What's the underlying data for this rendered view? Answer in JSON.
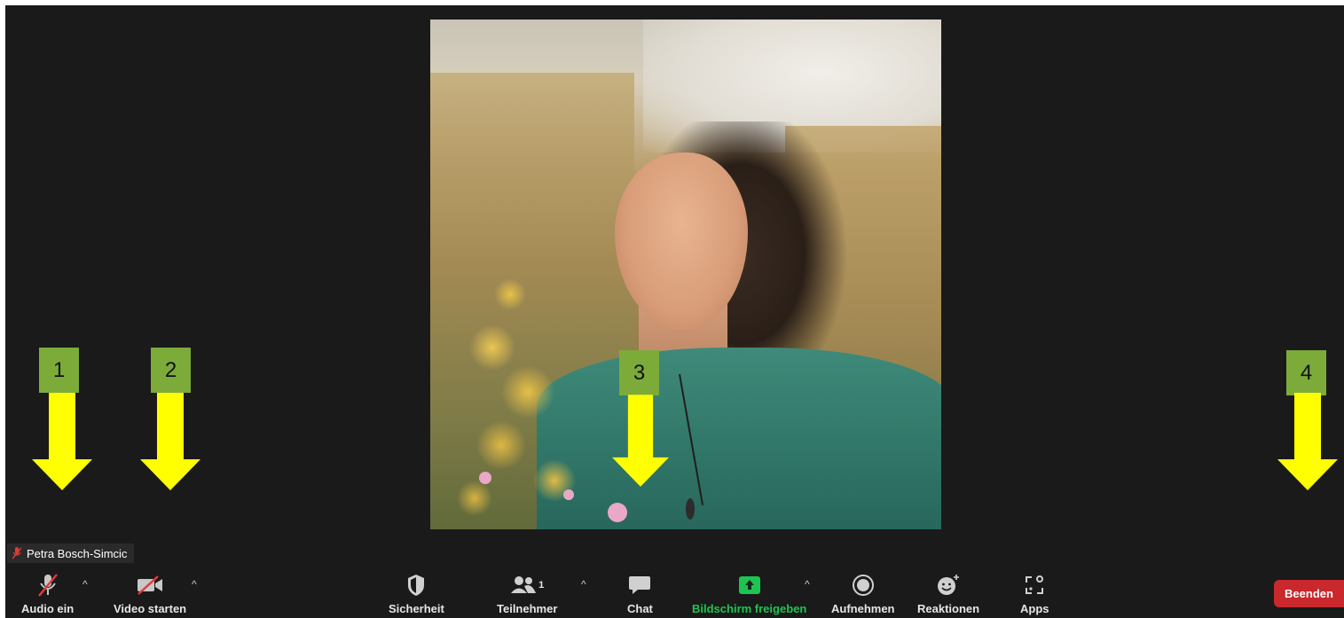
{
  "participant": {
    "name": "Petra Bosch-Simcic"
  },
  "markers": [
    "1",
    "2",
    "3",
    "4"
  ],
  "toolbar": {
    "audio_label": "Audio ein",
    "video_label": "Video starten",
    "security_label": "Sicherheit",
    "participants_label": "Teilnehmer",
    "participants_count": "1",
    "chat_label": "Chat",
    "share_label": "Bildschirm freigeben",
    "record_label": "Aufnehmen",
    "reactions_label": "Reaktionen",
    "apps_label": "Apps",
    "end_label": "Beenden"
  },
  "colors": {
    "background": "#1a1a1a",
    "share_accent": "#1ec451",
    "end_button": "#c9282d",
    "marker": "#7cab3a",
    "arrow": "#ffff00"
  }
}
